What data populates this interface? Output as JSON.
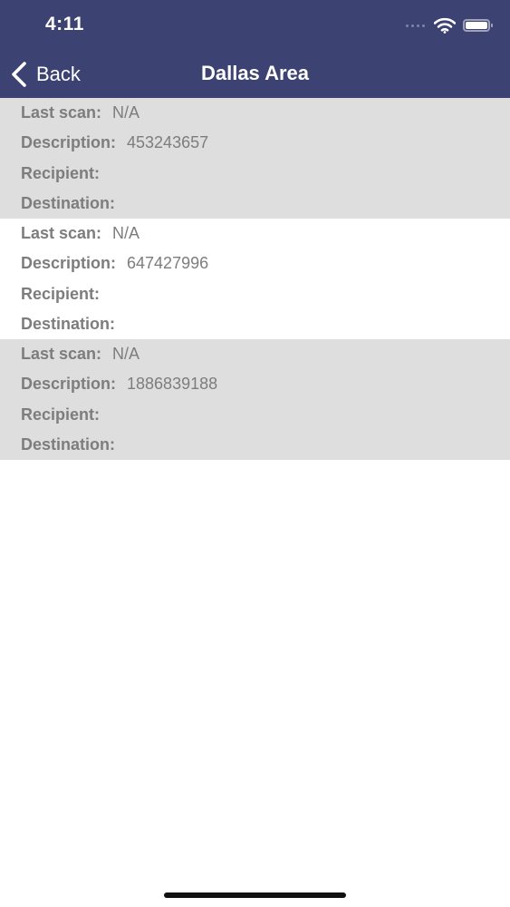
{
  "status_bar": {
    "time": "4:11"
  },
  "nav": {
    "back_label": "Back",
    "title": "Dallas Area"
  },
  "labels": {
    "last_scan": "Last scan:",
    "description": "Description:",
    "recipient": "Recipient:",
    "destination": "Destination:"
  },
  "items": [
    {
      "last_scan": "N/A",
      "description": "453243657",
      "recipient": "",
      "destination": ""
    },
    {
      "last_scan": "N/A",
      "description": "647427996",
      "recipient": "",
      "destination": ""
    },
    {
      "last_scan": "N/A",
      "description": "1886839188",
      "recipient": "",
      "destination": ""
    }
  ],
  "colors": {
    "nav_background": "#3c4271",
    "shaded_row": "#dedede",
    "text": "#7d7d7d"
  },
  "icons": [
    "back-chevron-icon",
    "cellular-signal-icon",
    "wifi-icon",
    "battery-icon"
  ]
}
